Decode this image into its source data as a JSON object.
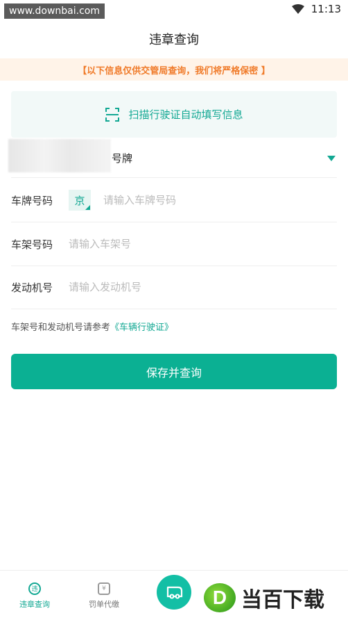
{
  "status": {
    "watermark": "www.downbai.com",
    "time": "11:13"
  },
  "page_title": "违章查询",
  "notice": "【以下信息仅供交管局查询，我们将严格保密 】",
  "scan": {
    "label": "扫描行驶证自动填写信息"
  },
  "plate_type": {
    "label": "号牌"
  },
  "form": {
    "plate": {
      "label": "车牌号码",
      "province": "京",
      "placeholder": "请输入车牌号码"
    },
    "frame": {
      "label": "车架号码",
      "placeholder": "请输入车架号"
    },
    "engine": {
      "label": "发动机号",
      "placeholder": "请输入发动机号"
    }
  },
  "hint": {
    "text": "车架号和发动机号请参考",
    "link": "《车辆行驶证》"
  },
  "submit_label": "保存并查询",
  "tabs": [
    {
      "label": "违章查询",
      "icon": "violation-icon",
      "active": true
    },
    {
      "label": "罚单代缴",
      "icon": "ticket-icon",
      "active": false
    }
  ],
  "brand": {
    "logo_letter": "D",
    "text": "当百下载"
  },
  "colors": {
    "accent": "#12a893",
    "button": "#0bb093",
    "notice_bg": "#fff3e8",
    "notice_text": "#f07b2a"
  }
}
